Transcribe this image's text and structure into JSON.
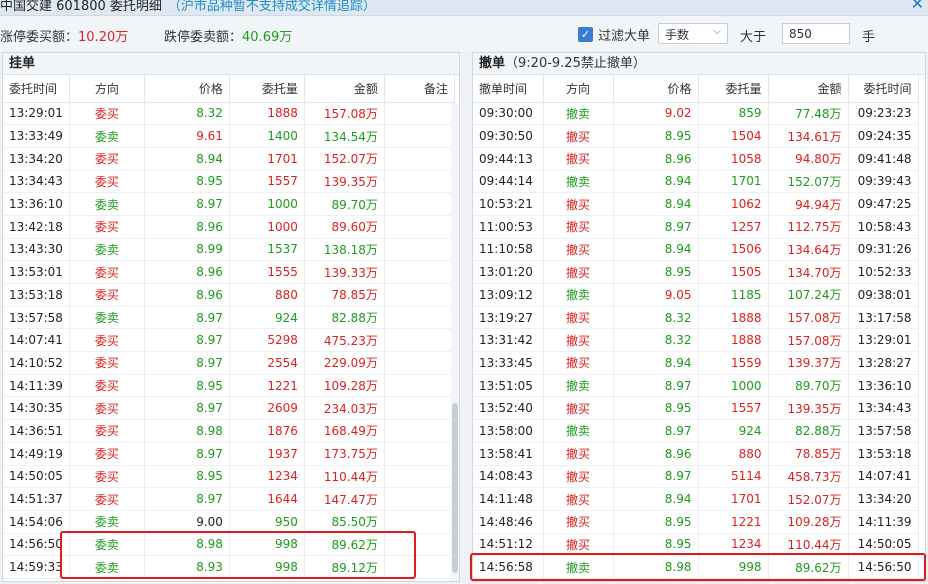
{
  "window": {
    "title": "中国交建 601800 委托明细",
    "note": "（沪市品种暂不支持成交详情追踪）"
  },
  "summary": {
    "up_label": "涨停委买额：",
    "up_value": "10.20万",
    "down_label": "跌停委卖额：",
    "down_value": "40.69万"
  },
  "filter": {
    "checkbox_checked": true,
    "checkbox_label": "过滤大单",
    "unit_value": "手数",
    "gt_label": "大于",
    "threshold": "850",
    "unit_suffix": "手"
  },
  "colors": {
    "up": "#e02020",
    "down": "#1e9b1e",
    "highlight": "#e11b1b",
    "accent": "#3a7bd5"
  },
  "pending": {
    "title": "挂单",
    "columns": [
      "委托时间",
      "方向",
      "价格",
      "委托量",
      "金额",
      "备注"
    ],
    "rows": [
      {
        "time": "13:29:01",
        "dir": "委买",
        "price": "8.32",
        "qty": "1888",
        "amount": "157.08万",
        "note": "",
        "price_color": "green",
        "qty_color": "red",
        "amount_color": "red"
      },
      {
        "time": "13:33:49",
        "dir": "委卖",
        "price": "9.61",
        "qty": "1400",
        "amount": "134.54万",
        "note": "",
        "price_color": "red",
        "qty_color": "green",
        "amount_color": "green"
      },
      {
        "time": "13:34:20",
        "dir": "委买",
        "price": "8.94",
        "qty": "1701",
        "amount": "152.07万",
        "note": "",
        "price_color": "green",
        "qty_color": "red",
        "amount_color": "red"
      },
      {
        "time": "13:34:43",
        "dir": "委买",
        "price": "8.95",
        "qty": "1557",
        "amount": "139.35万",
        "note": "",
        "price_color": "green",
        "qty_color": "red",
        "amount_color": "red"
      },
      {
        "time": "13:36:10",
        "dir": "委卖",
        "price": "8.97",
        "qty": "1000",
        "amount": "89.70万",
        "note": "",
        "price_color": "green",
        "qty_color": "green",
        "amount_color": "green"
      },
      {
        "time": "13:42:18",
        "dir": "委买",
        "price": "8.96",
        "qty": "1000",
        "amount": "89.60万",
        "note": "",
        "price_color": "green",
        "qty_color": "red",
        "amount_color": "red"
      },
      {
        "time": "13:43:30",
        "dir": "委卖",
        "price": "8.99",
        "qty": "1537",
        "amount": "138.18万",
        "note": "",
        "price_color": "green",
        "qty_color": "green",
        "amount_color": "green"
      },
      {
        "time": "13:53:01",
        "dir": "委买",
        "price": "8.96",
        "qty": "1555",
        "amount": "139.33万",
        "note": "",
        "price_color": "green",
        "qty_color": "red",
        "amount_color": "red"
      },
      {
        "time": "13:53:18",
        "dir": "委买",
        "price": "8.96",
        "qty": "880",
        "amount": "78.85万",
        "note": "",
        "price_color": "green",
        "qty_color": "red",
        "amount_color": "red"
      },
      {
        "time": "13:57:58",
        "dir": "委卖",
        "price": "8.97",
        "qty": "924",
        "amount": "82.88万",
        "note": "",
        "price_color": "green",
        "qty_color": "green",
        "amount_color": "green"
      },
      {
        "time": "14:07:41",
        "dir": "委买",
        "price": "8.97",
        "qty": "5298",
        "amount": "475.23万",
        "note": "",
        "price_color": "green",
        "qty_color": "red",
        "amount_color": "red"
      },
      {
        "time": "14:10:52",
        "dir": "委买",
        "price": "8.97",
        "qty": "2554",
        "amount": "229.09万",
        "note": "",
        "price_color": "green",
        "qty_color": "red",
        "amount_color": "red"
      },
      {
        "time": "14:11:39",
        "dir": "委买",
        "price": "8.95",
        "qty": "1221",
        "amount": "109.28万",
        "note": "",
        "price_color": "green",
        "qty_color": "red",
        "amount_color": "red"
      },
      {
        "time": "14:30:35",
        "dir": "委买",
        "price": "8.97",
        "qty": "2609",
        "amount": "234.03万",
        "note": "",
        "price_color": "green",
        "qty_color": "red",
        "amount_color": "red"
      },
      {
        "time": "14:36:51",
        "dir": "委买",
        "price": "8.98",
        "qty": "1876",
        "amount": "168.49万",
        "note": "",
        "price_color": "green",
        "qty_color": "red",
        "amount_color": "red"
      },
      {
        "time": "14:49:19",
        "dir": "委买",
        "price": "8.97",
        "qty": "1937",
        "amount": "173.75万",
        "note": "",
        "price_color": "green",
        "qty_color": "red",
        "amount_color": "red"
      },
      {
        "time": "14:50:05",
        "dir": "委买",
        "price": "8.95",
        "qty": "1234",
        "amount": "110.44万",
        "note": "",
        "price_color": "green",
        "qty_color": "red",
        "amount_color": "red"
      },
      {
        "time": "14:51:37",
        "dir": "委买",
        "price": "8.97",
        "qty": "1644",
        "amount": "147.47万",
        "note": "",
        "price_color": "green",
        "qty_color": "red",
        "amount_color": "red"
      },
      {
        "time": "14:54:06",
        "dir": "委卖",
        "price": "9.00",
        "qty": "950",
        "amount": "85.50万",
        "note": "",
        "price_color": "black",
        "qty_color": "green",
        "amount_color": "green"
      },
      {
        "time": "14:56:50",
        "dir": "委卖",
        "price": "8.98",
        "qty": "998",
        "amount": "89.62万",
        "note": "",
        "price_color": "green",
        "qty_color": "green",
        "amount_color": "green"
      },
      {
        "time": "14:59:33",
        "dir": "委卖",
        "price": "8.93",
        "qty": "998",
        "amount": "89.12万",
        "note": "",
        "price_color": "green",
        "qty_color": "green",
        "amount_color": "green"
      }
    ]
  },
  "cancelled": {
    "title": "撤单",
    "subtitle": "（9:20-9.25禁止撤单）",
    "columns": [
      "撤单时间",
      "方向",
      "价格",
      "委托量",
      "金额",
      "委托时间"
    ],
    "rows": [
      {
        "time": "09:30:00",
        "dir": "撤卖",
        "price": "9.02",
        "qty": "859",
        "amount": "77.48万",
        "order_time": "09:23:23",
        "price_color": "red",
        "qty_color": "green",
        "amount_color": "green"
      },
      {
        "time": "09:30:50",
        "dir": "撤买",
        "price": "8.95",
        "qty": "1504",
        "amount": "134.61万",
        "order_time": "09:24:35",
        "price_color": "green",
        "qty_color": "red",
        "amount_color": "red"
      },
      {
        "time": "09:44:13",
        "dir": "撤买",
        "price": "8.96",
        "qty": "1058",
        "amount": "94.80万",
        "order_time": "09:41:48",
        "price_color": "green",
        "qty_color": "red",
        "amount_color": "red"
      },
      {
        "time": "09:44:14",
        "dir": "撤卖",
        "price": "8.94",
        "qty": "1701",
        "amount": "152.07万",
        "order_time": "09:39:43",
        "price_color": "green",
        "qty_color": "green",
        "amount_color": "green"
      },
      {
        "time": "10:53:21",
        "dir": "撤买",
        "price": "8.94",
        "qty": "1062",
        "amount": "94.94万",
        "order_time": "09:47:25",
        "price_color": "green",
        "qty_color": "red",
        "amount_color": "red"
      },
      {
        "time": "11:00:53",
        "dir": "撤买",
        "price": "8.97",
        "qty": "1257",
        "amount": "112.75万",
        "order_time": "10:58:43",
        "price_color": "green",
        "qty_color": "red",
        "amount_color": "red"
      },
      {
        "time": "11:10:58",
        "dir": "撤买",
        "price": "8.94",
        "qty": "1506",
        "amount": "134.64万",
        "order_time": "09:31:26",
        "price_color": "green",
        "qty_color": "red",
        "amount_color": "red"
      },
      {
        "time": "13:01:20",
        "dir": "撤买",
        "price": "8.95",
        "qty": "1505",
        "amount": "134.70万",
        "order_time": "10:52:33",
        "price_color": "green",
        "qty_color": "red",
        "amount_color": "red"
      },
      {
        "time": "13:09:12",
        "dir": "撤卖",
        "price": "9.05",
        "qty": "1185",
        "amount": "107.24万",
        "order_time": "09:38:01",
        "price_color": "red",
        "qty_color": "green",
        "amount_color": "green"
      },
      {
        "time": "13:19:27",
        "dir": "撤买",
        "price": "8.32",
        "qty": "1888",
        "amount": "157.08万",
        "order_time": "13:17:58",
        "price_color": "green",
        "qty_color": "red",
        "amount_color": "red"
      },
      {
        "time": "13:31:42",
        "dir": "撤买",
        "price": "8.32",
        "qty": "1888",
        "amount": "157.08万",
        "order_time": "13:29:01",
        "price_color": "green",
        "qty_color": "red",
        "amount_color": "red"
      },
      {
        "time": "13:33:45",
        "dir": "撤买",
        "price": "8.94",
        "qty": "1559",
        "amount": "139.37万",
        "order_time": "13:28:27",
        "price_color": "green",
        "qty_color": "red",
        "amount_color": "red"
      },
      {
        "time": "13:51:05",
        "dir": "撤卖",
        "price": "8.97",
        "qty": "1000",
        "amount": "89.70万",
        "order_time": "13:36:10",
        "price_color": "green",
        "qty_color": "green",
        "amount_color": "green"
      },
      {
        "time": "13:52:40",
        "dir": "撤买",
        "price": "8.95",
        "qty": "1557",
        "amount": "139.35万",
        "order_time": "13:34:43",
        "price_color": "green",
        "qty_color": "red",
        "amount_color": "red"
      },
      {
        "time": "13:58:00",
        "dir": "撤卖",
        "price": "8.97",
        "qty": "924",
        "amount": "82.88万",
        "order_time": "13:57:58",
        "price_color": "green",
        "qty_color": "green",
        "amount_color": "green"
      },
      {
        "time": "13:58:41",
        "dir": "撤买",
        "price": "8.96",
        "qty": "880",
        "amount": "78.85万",
        "order_time": "13:53:18",
        "price_color": "green",
        "qty_color": "red",
        "amount_color": "red"
      },
      {
        "time": "14:08:43",
        "dir": "撤买",
        "price": "8.97",
        "qty": "5114",
        "amount": "458.73万",
        "order_time": "14:07:41",
        "price_color": "green",
        "qty_color": "red",
        "amount_color": "red"
      },
      {
        "time": "14:11:48",
        "dir": "撤买",
        "price": "8.94",
        "qty": "1701",
        "amount": "152.07万",
        "order_time": "13:34:20",
        "price_color": "green",
        "qty_color": "red",
        "amount_color": "red"
      },
      {
        "time": "14:48:46",
        "dir": "撤买",
        "price": "8.95",
        "qty": "1221",
        "amount": "109.28万",
        "order_time": "14:11:39",
        "price_color": "green",
        "qty_color": "red",
        "amount_color": "red"
      },
      {
        "time": "14:51:12",
        "dir": "撤买",
        "price": "8.95",
        "qty": "1234",
        "amount": "110.44万",
        "order_time": "14:50:05",
        "price_color": "green",
        "qty_color": "red",
        "amount_color": "red"
      },
      {
        "time": "14:56:58",
        "dir": "撤卖",
        "price": "8.98",
        "qty": "998",
        "amount": "89.62万",
        "order_time": "14:56:50",
        "price_color": "green",
        "qty_color": "green",
        "amount_color": "green"
      }
    ]
  }
}
